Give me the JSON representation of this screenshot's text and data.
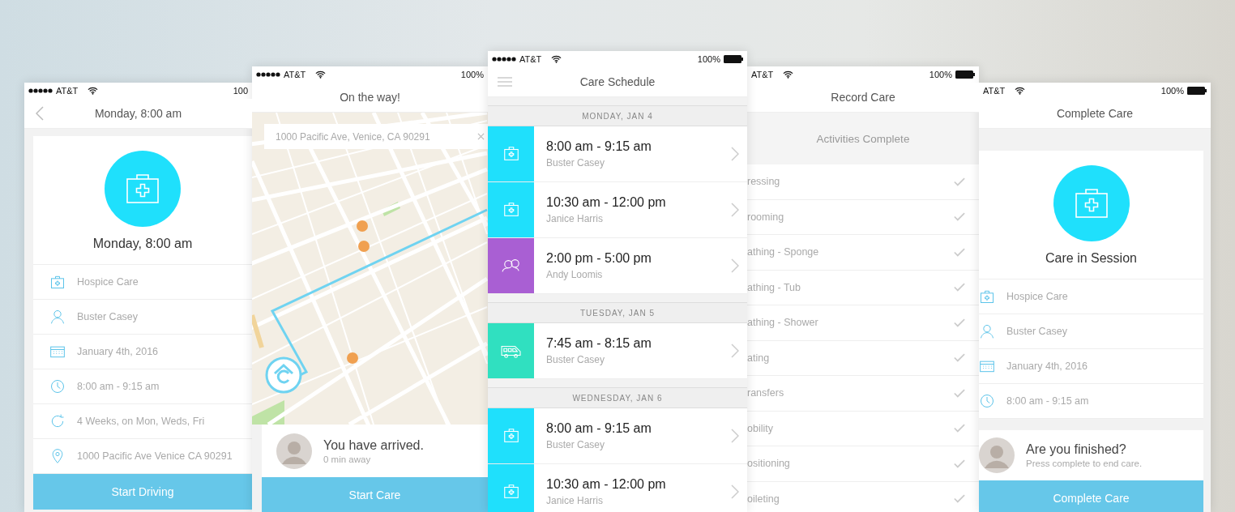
{
  "screens": [
    {
      "kind": "detail",
      "status": {
        "carrier": "AT&T",
        "signal": true,
        "battery": "100",
        "battery_icon": false
      },
      "nav_button": {
        "kind": "back"
      },
      "title": "Monday, 8:00 am",
      "hero": "Monday, 8:00 am",
      "details": [
        {
          "kind": "kit",
          "text": "Hospice Care"
        },
        {
          "kind": "person",
          "text": "Buster Casey"
        },
        {
          "kind": "calendar",
          "text": "January 4th, 2016"
        },
        {
          "kind": "clock",
          "text": "8:00 am - 9:15 am"
        },
        {
          "kind": "repeat",
          "text": "4 Weeks, on Mon, Weds, Fri"
        },
        {
          "kind": "pin",
          "text": "1000 Pacific Ave Venice CA 90291"
        }
      ],
      "button": "Start Driving"
    },
    {
      "kind": "map",
      "status": {
        "carrier": "AT&T",
        "signal": true,
        "battery": "100%",
        "battery_icon": false
      },
      "title": "On the way!",
      "search": {
        "value": "1000 Pacific Ave, Venice, CA 90291"
      },
      "prompt": {
        "title": "You have arrived.",
        "subtitle": "0 min away"
      },
      "button": "Start Care"
    },
    {
      "kind": "schedule",
      "status": {
        "carrier": "AT&T",
        "signal": true,
        "battery": "100%",
        "battery_icon": true
      },
      "nav_button": {
        "kind": "menu"
      },
      "title": "Care Schedule",
      "sections": [
        {
          "heading": "MONDAY, JAN 4",
          "visits": [
            {
              "kind": "care",
              "color": "#1fe0fc",
              "time": "8:00 am - 9:15 am",
              "client": "Buster Casey"
            },
            {
              "kind": "care",
              "color": "#1fe0fc",
              "time": "10:30 am - 12:00 pm",
              "client": "Janice Harris"
            },
            {
              "kind": "companion",
              "color": "#a95fd3",
              "time": "2:00 pm - 5:00 pm",
              "client": "Andy Loomis"
            }
          ]
        },
        {
          "heading": "TUESDAY, JAN 5",
          "visits": [
            {
              "kind": "transport",
              "color": "#30e0c0",
              "time": "7:45 am - 8:15 am",
              "client": "Buster Casey"
            }
          ]
        },
        {
          "heading": "WEDNESDAY, JAN 6",
          "visits": [
            {
              "kind": "care",
              "color": "#1fe0fc",
              "time": "8:00 am - 9:15 am",
              "client": "Buster Casey"
            },
            {
              "kind": "care",
              "color": "#1fe0fc",
              "time": "10:30 am - 12:00 pm",
              "client": "Janice Harris"
            }
          ]
        }
      ]
    },
    {
      "kind": "record",
      "status": {
        "carrier": "AT&T",
        "signal": false,
        "battery": "100%",
        "battery_icon": true
      },
      "title": "Record Care",
      "banner": "Activities Complete",
      "activities": [
        {
          "name": "ressing",
          "checked": true
        },
        {
          "name": "rooming",
          "checked": true
        },
        {
          "name": "athing - Sponge",
          "checked": true
        },
        {
          "name": "athing - Tub",
          "checked": true
        },
        {
          "name": "athing - Shower",
          "checked": true
        },
        {
          "name": "ating",
          "checked": true
        },
        {
          "name": "ransfers",
          "checked": true
        },
        {
          "name": "obility",
          "checked": true
        },
        {
          "name": "ositioning",
          "checked": true
        },
        {
          "name": "oileting",
          "checked": true
        }
      ]
    },
    {
      "kind": "complete",
      "status": {
        "carrier": "AT&T",
        "signal": false,
        "battery": "100%",
        "battery_icon": true
      },
      "title": "Complete Care",
      "hero": "Care in Session",
      "details": [
        {
          "kind": "kit",
          "text": "Hospice Care"
        },
        {
          "kind": "person",
          "text": "Buster Casey"
        },
        {
          "kind": "calendar",
          "text": "January 4th, 2016"
        },
        {
          "kind": "clock",
          "text": "8:00 am - 9:15 am"
        }
      ],
      "prompt": {
        "title": "Are you finished?",
        "subtitle": "Press complete to end care."
      },
      "button": "Complete Care"
    }
  ]
}
